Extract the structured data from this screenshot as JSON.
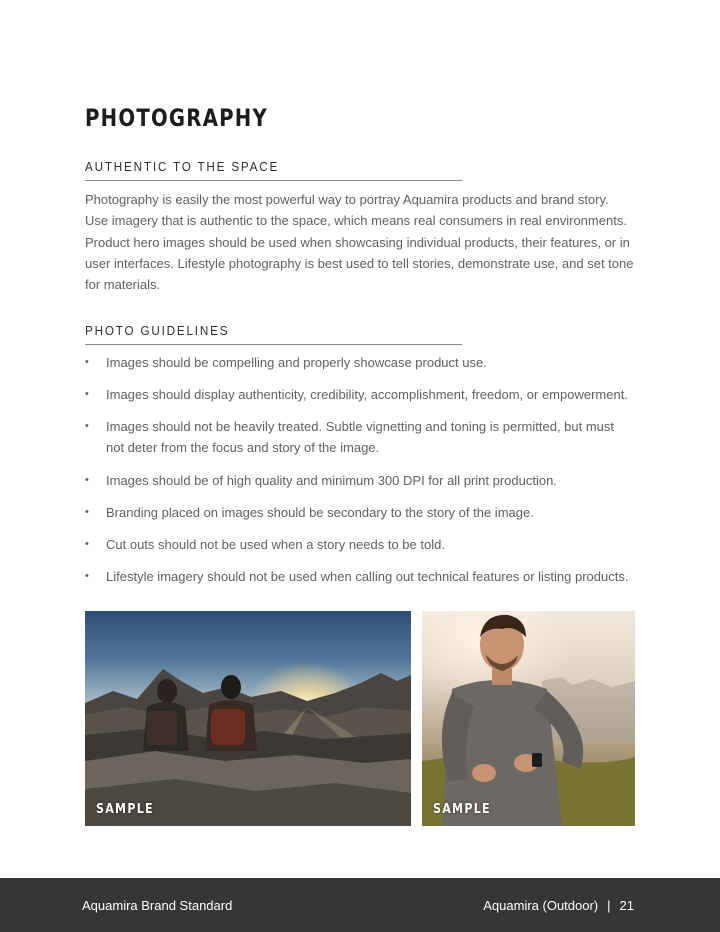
{
  "page": {
    "title": "PHOTOGRAPHY"
  },
  "section_authentic": {
    "heading": "AUTHENTIC TO THE SPACE",
    "body": "Photography is easily the most powerful way to portray Aquamira products and brand story. Use imagery that is authentic to the space, which means real consumers in real environments. Product hero images should be used when showcasing individual products, their features, or in user interfaces. Lifestyle photography is best used to tell stories, demonstrate use, and set tone for materials."
  },
  "section_guidelines": {
    "heading": "PHOTO GUIDELINES",
    "bullet_glyph": "•",
    "items": [
      "Images should be compelling and properly showcase product use.",
      "Images should display authenticity, credibility, accomplishment, freedom, or empowerment.",
      "Images should not be heavily treated. Subtle vignetting and toning is permitted, but must not deter from the focus and story of the image.",
      "Images should be of high quality and minimum 300 DPI for all print production.",
      "Branding placed on images should be secondary to the story of the image.",
      "Cut outs should not be used when a story needs to be told.",
      "Lifestyle imagery should not be used when calling out technical features or listing products."
    ]
  },
  "photos": {
    "hikers": {
      "label": "SAMPLE"
    },
    "man": {
      "label": "SAMPLE"
    }
  },
  "footer": {
    "left": "Aquamira Brand Standard",
    "right_label": "Aquamira (Outdoor)",
    "separator": "|",
    "page_number": "21"
  },
  "colors": {
    "footer_bg": "#383536",
    "title": "#1c1c1c",
    "body_text": "#5f6062"
  }
}
